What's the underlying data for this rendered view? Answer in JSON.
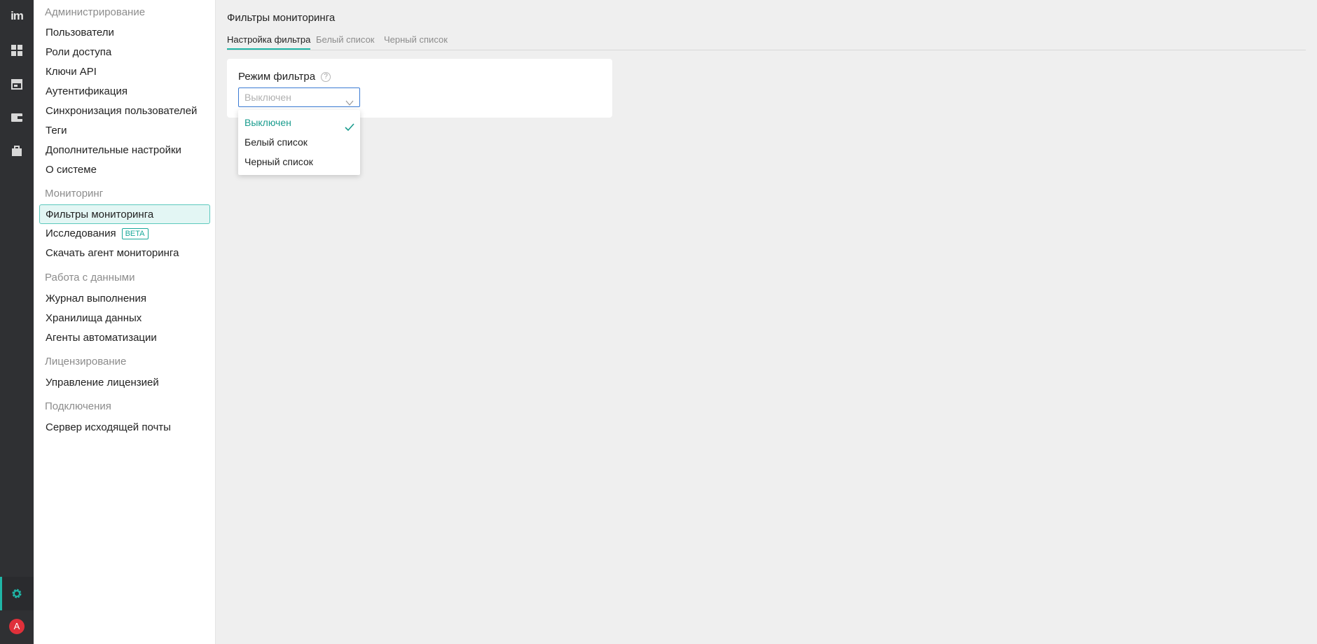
{
  "rail": {
    "logo": "im",
    "icons": [
      "dashboard-icon",
      "store-icon",
      "wallet-icon",
      "briefcase-icon",
      "settings-icon"
    ],
    "avatar_letter": "A"
  },
  "sidebar": {
    "groups": [
      {
        "title": "Администрирование",
        "items": [
          "Пользователи",
          "Роли доступа",
          "Ключи API",
          "Аутентификация",
          "Синхронизация пользователей",
          "Теги",
          "Дополнительные настройки",
          "О системе"
        ]
      },
      {
        "title": "Мониторинг",
        "items": [
          "Фильтры мониторинга",
          "Исследования",
          "Скачать агент мониторинга"
        ]
      },
      {
        "title": "Работа с данными",
        "items": [
          "Журнал выполнения",
          "Хранилища данных",
          "Агенты автоматизации"
        ]
      },
      {
        "title": "Лицензирование",
        "items": [
          "Управление лицензией"
        ]
      },
      {
        "title": "Подключения",
        "items": [
          "Сервер исходящей почты"
        ]
      }
    ],
    "active_item": "Фильтры мониторинга",
    "beta_badge": "BETA"
  },
  "main": {
    "title": "Фильтры мониторинга",
    "tabs": [
      {
        "label": "Настройка фильтра",
        "active": true
      },
      {
        "label": "Белый список",
        "active": false
      },
      {
        "label": "Черный список",
        "active": false
      }
    ],
    "filter_mode": {
      "label": "Режим фильтра",
      "placeholder": "Выключен",
      "options": [
        "Выключен",
        "Белый список",
        "Черный список"
      ],
      "selected": "Выключен"
    }
  },
  "colors": {
    "accent": "#1fb5a6",
    "rail_bg": "#2f3033",
    "focus_border": "#3b7bd4",
    "avatar_bg": "#e0303a"
  }
}
